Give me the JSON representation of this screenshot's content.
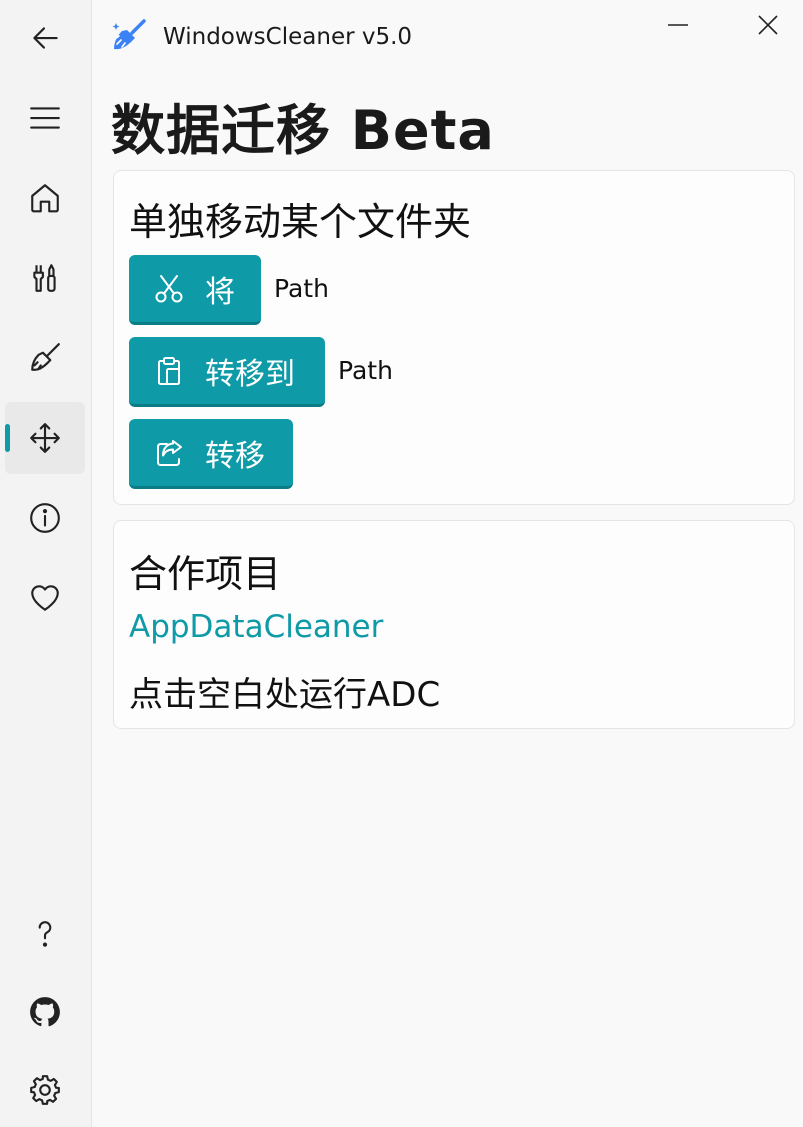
{
  "app": {
    "title": "WindowsCleaner v5.0"
  },
  "page": {
    "title": "数据迁移 Beta"
  },
  "move_card": {
    "title": "单独移动某个文件夹",
    "source_button_label": "将",
    "source_path": "Path",
    "target_button_label": "转移到",
    "target_path": "Path",
    "move_button_label": "转移"
  },
  "partner_card": {
    "title": "合作项目",
    "link_text": "AppDataCleaner",
    "hint": "点击空白处运行ADC"
  },
  "colors": {
    "accent": "#0e9aa7",
    "app_icon": "#3b82f6"
  }
}
